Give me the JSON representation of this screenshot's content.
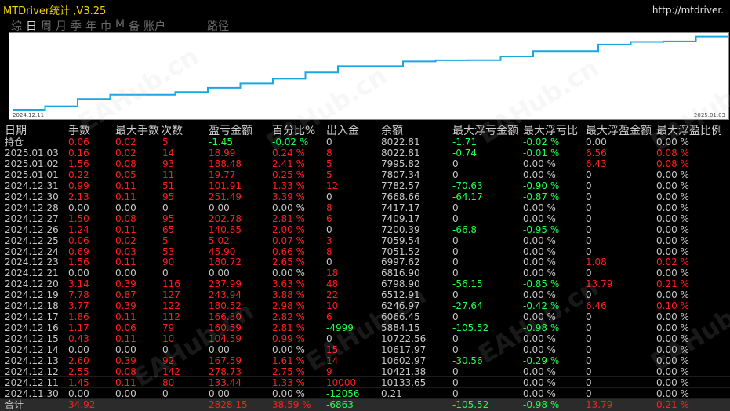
{
  "app": {
    "title": "MTDriver统计 ,V3.25",
    "url": "http://mtdriver."
  },
  "toolbar": [
    {
      "label": "综",
      "active": false
    },
    {
      "label": "日",
      "active": true
    },
    {
      "label": "周",
      "active": false
    },
    {
      "label": "月",
      "active": false
    },
    {
      "label": "季",
      "active": false
    },
    {
      "label": "年",
      "active": false
    },
    {
      "label": "巾",
      "active": false
    },
    {
      "label": "M",
      "active": false
    },
    {
      "label": "备",
      "active": false
    },
    {
      "label": "账户",
      "active": false
    },
    {
      "label": "路径",
      "active": false
    }
  ],
  "chart": {
    "start_label": "2024.12.11",
    "end_label": "2025.01.03",
    "line_color": "#1aa7e0"
  },
  "watermark": "EAHub.cn",
  "headers": [
    "日期",
    "手数",
    "最大手数",
    "次数",
    "盈亏金额",
    "百分比%",
    "出入金",
    "余额",
    "最大浮亏金额",
    "最大浮亏比",
    "最大浮盈金额",
    "最大浮盈比例"
  ],
  "rows": [
    [
      "持仓",
      "0.06",
      "0.02",
      "5",
      "-1.45",
      "-0.02 %",
      "0",
      "8022.81",
      "-1.71",
      "-0.02 %",
      "0.00",
      "0.00 %"
    ],
    [
      "2025.01.03",
      "0.16",
      "0.02",
      "14",
      "18.99",
      "0.24 %",
      "8",
      "8022.81",
      "-0.74",
      "-0.01 %",
      "6.56",
      "0.08 %"
    ],
    [
      "2025.01.02",
      "1.56",
      "0.08",
      "93",
      "188.48",
      "2.41 %",
      "5",
      "7995.82",
      "0",
      "0.00 %",
      "6.43",
      "0.08 %"
    ],
    [
      "2025.01.01",
      "0.22",
      "0.05",
      "11",
      "19.77",
      "0.25 %",
      "5",
      "7807.34",
      "0",
      "0.00 %",
      "0",
      "0.00 %"
    ],
    [
      "2024.12.31",
      "0.99",
      "0.11",
      "51",
      "101.91",
      "1.33 %",
      "12",
      "7782.57",
      "-70.63",
      "-0.90 %",
      "0",
      "0.00 %"
    ],
    [
      "2024.12.30",
      "2.13",
      "0.11",
      "95",
      "251.49",
      "3.39 %",
      "0",
      "7668.66",
      "-64.17",
      "-0.87 %",
      "0",
      "0.00 %"
    ],
    [
      "2024.12.28",
      "0.00",
      "0.00",
      "0",
      "0.00",
      "0.00 %",
      "8",
      "7417.17",
      "0",
      "0.00 %",
      "0",
      "0.00 %"
    ],
    [
      "2024.12.27",
      "1.50",
      "0.08",
      "95",
      "202.78",
      "2.81 %",
      "6",
      "7409.17",
      "0",
      "0.00 %",
      "0",
      "0.00 %"
    ],
    [
      "2024.12.26",
      "1.24",
      "0.11",
      "65",
      "140.85",
      "2.00 %",
      "0",
      "7200.39",
      "-66.8",
      "-0.95 %",
      "0",
      "0.00 %"
    ],
    [
      "2024.12.25",
      "0.06",
      "0.02",
      "5",
      "5.02",
      "0.07 %",
      "3",
      "7059.54",
      "0",
      "0.00 %",
      "0",
      "0.00 %"
    ],
    [
      "2024.12.24",
      "0.69",
      "0.03",
      "53",
      "45.90",
      "0.66 %",
      "8",
      "7051.52",
      "0",
      "0.00 %",
      "0",
      "0.00 %"
    ],
    [
      "2024.12.23",
      "1.56",
      "0.11",
      "90",
      "180.72",
      "2.65 %",
      "0",
      "6997.62",
      "0",
      "0.00 %",
      "1.08",
      "0.02 %"
    ],
    [
      "2024.12.21",
      "0.00",
      "0.00",
      "0",
      "0.00",
      "0.00 %",
      "18",
      "6816.90",
      "0",
      "0.00 %",
      "0",
      "0.00 %"
    ],
    [
      "2024.12.20",
      "3.14",
      "0.39",
      "116",
      "237.99",
      "3.63 %",
      "48",
      "6798.90",
      "-56.15",
      "-0.85 %",
      "13.79",
      "0.21 %"
    ],
    [
      "2024.12.19",
      "7.78",
      "0.87",
      "127",
      "243.94",
      "3.88 %",
      "22",
      "6512.91",
      "0",
      "0.00 %",
      "0",
      "0.00 %"
    ],
    [
      "2024.12.18",
      "3.77",
      "0.39",
      "122",
      "180.52",
      "2.98 %",
      "10",
      "6246.97",
      "-27.64",
      "-0.42 %",
      "6.46",
      "0.10 %"
    ],
    [
      "2024.12.17",
      "1.86",
      "0.11",
      "112",
      "166.30",
      "2.82 %",
      "6",
      "6066.45",
      "0",
      "0.00 %",
      "0",
      "0.00 %"
    ],
    [
      "2024.12.16",
      "1.17",
      "0.06",
      "79",
      "160.59",
      "2.81 %",
      "-4999",
      "5884.15",
      "-105.52",
      "-0.98 %",
      "0",
      "0.00 %"
    ],
    [
      "2024.12.15",
      "0.43",
      "0.11",
      "10",
      "104.59",
      "0.99 %",
      "0",
      "10722.56",
      "0",
      "0.00 %",
      "0",
      "0.00 %"
    ],
    [
      "2024.12.14",
      "0.00",
      "0.00",
      "0",
      "0.00",
      "0.00 %",
      "15",
      "10617.97",
      "0",
      "0.00 %",
      "0",
      "0.00 %"
    ],
    [
      "2024.12.13",
      "2.60",
      "0.39",
      "92",
      "167.59",
      "1.61 %",
      "14",
      "10602.97",
      "-30.56",
      "-0.29 %",
      "0",
      "0.00 %"
    ],
    [
      "2024.12.12",
      "2.55",
      "0.08",
      "142",
      "278.73",
      "2.75 %",
      "9",
      "10421.38",
      "0",
      "0.00 %",
      "0",
      "0.00 %"
    ],
    [
      "2024.12.11",
      "1.45",
      "0.11",
      "80",
      "133.44",
      "1.33 %",
      "10000",
      "10133.65",
      "0",
      "0.00 %",
      "0",
      "0.00 %"
    ],
    [
      "2024.11.30",
      "0.00",
      "0.00",
      "0",
      "0.00",
      "0.00 %",
      "-12056",
      "0.21",
      "0",
      "0.00 %",
      "0",
      "0.00 %"
    ]
  ],
  "total": [
    "合计",
    "34.92",
    "",
    "",
    "2828.15",
    "38.59 %",
    "-6863",
    "",
    "-105.52",
    "-0.98 %",
    "13.79",
    "0.21 %"
  ],
  "colors": {
    "red": "#ff1f1f",
    "green": "#1fff4c",
    "title": "#f2d200"
  }
}
